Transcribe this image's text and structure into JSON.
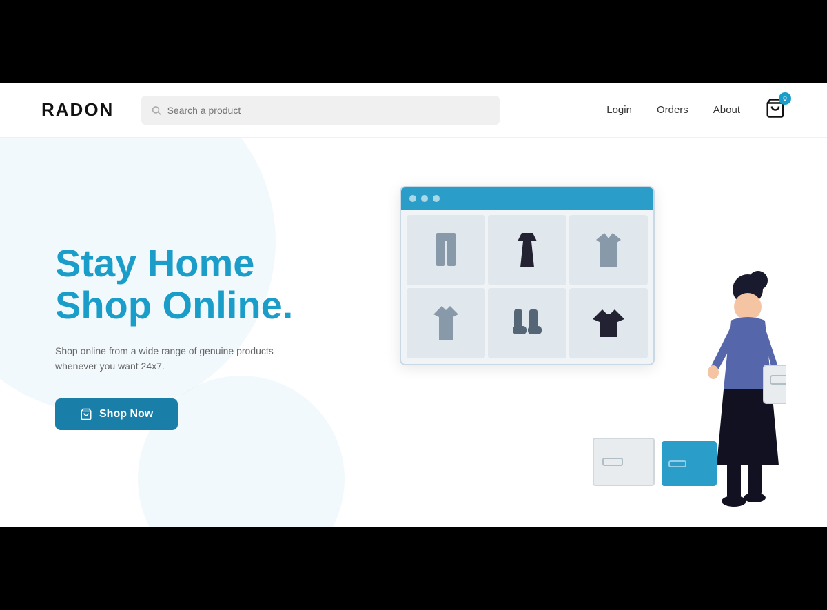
{
  "brand": {
    "name": "RADON"
  },
  "navbar": {
    "search_placeholder": "Search a product",
    "links": [
      {
        "label": "Login",
        "id": "login"
      },
      {
        "label": "Orders",
        "id": "orders"
      },
      {
        "label": "About",
        "id": "about"
      }
    ],
    "cart_count": "0"
  },
  "hero": {
    "title_line1": "Stay Home",
    "title_line2": "Shop Online.",
    "subtitle": "Shop online from a wide range of genuine products whenever you want 24x7.",
    "cta_label": "Shop Now"
  }
}
